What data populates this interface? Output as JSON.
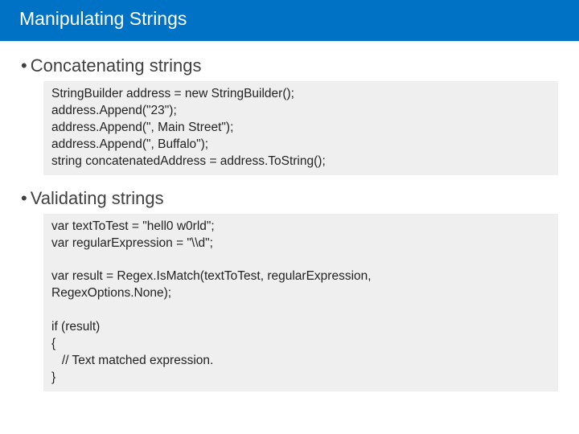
{
  "header": {
    "title": "Manipulating Strings"
  },
  "section1": {
    "heading": "Concatenating strings",
    "code": "StringBuilder address = new StringBuilder();\naddress.Append(\"23\");\naddress.Append(\", Main Street\");\naddress.Append(\", Buffalo\");\nstring concatenatedAddress = address.ToString();"
  },
  "section2": {
    "heading": "Validating strings",
    "code": "var textToTest = \"hell0 w0rld\";\nvar regularExpression = \"\\\\d\";\n\nvar result = Regex.IsMatch(textToTest, regularExpression,\nRegexOptions.None);\n\nif (result)\n{\n   // Text matched expression.\n}"
  }
}
